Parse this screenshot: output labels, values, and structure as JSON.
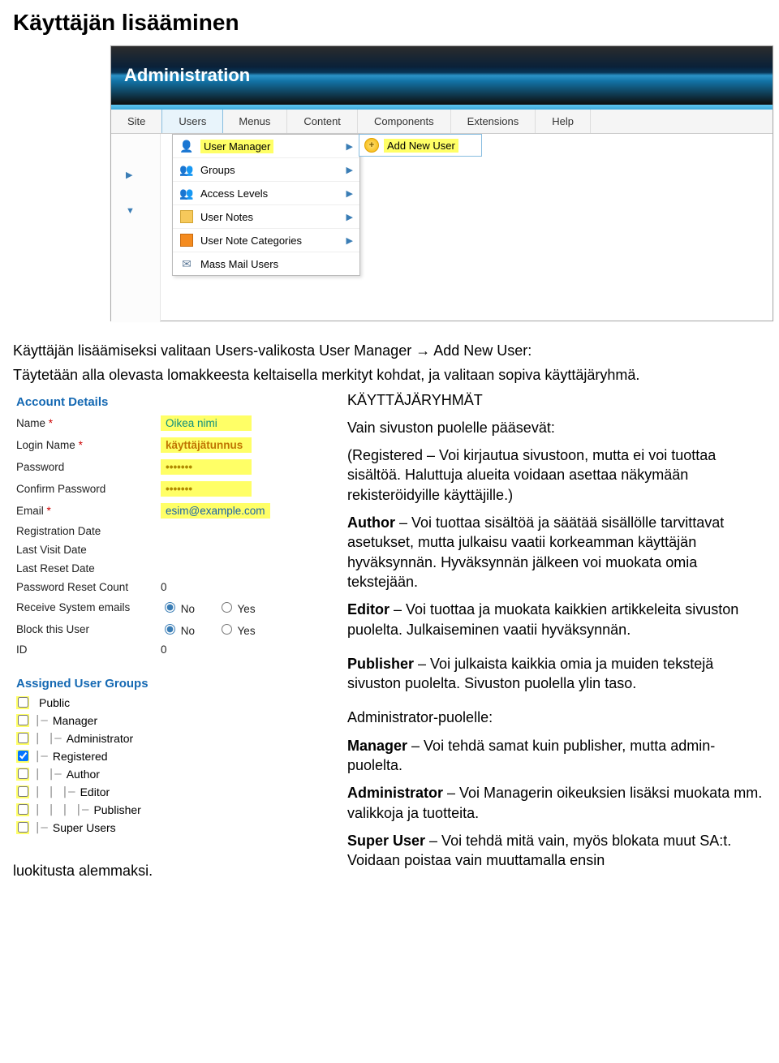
{
  "page_title": "Käyttäjän lisääminen",
  "admin": {
    "header": "Administration",
    "menu": [
      "Site",
      "Users",
      "Menus",
      "Content",
      "Components",
      "Extensions",
      "Help"
    ],
    "active": 1,
    "dropdown": [
      {
        "label": "User Manager",
        "icon": "user",
        "hl": true,
        "arrow": true
      },
      {
        "label": "Groups",
        "icon": "group",
        "arrow": true
      },
      {
        "label": "Access Levels",
        "icon": "group",
        "arrow": true
      },
      {
        "label": "User Notes",
        "icon": "note",
        "arrow": true
      },
      {
        "label": "User Note Categories",
        "icon": "cat",
        "arrow": true
      },
      {
        "label": "Mass Mail Users",
        "icon": "mail",
        "arrow": false
      }
    ],
    "submenu": {
      "label": "Add New User"
    }
  },
  "intro_lines": {
    "l1": "Käyttäjän lisäämiseksi valitaan Users-valikosta User Manager → Add New User:",
    "l2": "Täytetään alla olevasta lomakkeesta keltaisella merkityt kohdat, ja valitaan sopiva käyttäjäryhmä."
  },
  "form": {
    "heading": "Account Details",
    "rows": {
      "name_lbl": "Name",
      "name_val": "Oikea nimi",
      "login_lbl": "Login Name",
      "login_val": "käyttäjätunnus",
      "pw_lbl": "Password",
      "pw_val": "•••••••",
      "cpw_lbl": "Confirm Password",
      "cpw_val": "•••••••",
      "email_lbl": "Email",
      "email_val": "esim@example.com",
      "regdate_lbl": "Registration Date",
      "lastvisit_lbl": "Last Visit Date",
      "lastreset_lbl": "Last Reset Date",
      "pwreset_lbl": "Password Reset Count",
      "pwreset_val": "0",
      "sysmail_lbl": "Receive System emails",
      "block_lbl": "Block this User",
      "id_lbl": "ID",
      "id_val": "0",
      "no": "No",
      "yes": "Yes"
    }
  },
  "groups": {
    "heading": "Assigned User Groups",
    "items": [
      {
        "label": "Public",
        "indent": "",
        "checked": false
      },
      {
        "label": "Manager",
        "indent": "|— ",
        "checked": false
      },
      {
        "label": "Administrator",
        "indent": "|    |— ",
        "checked": false
      },
      {
        "label": "Registered",
        "indent": "|— ",
        "checked": true
      },
      {
        "label": "Author",
        "indent": "|    |— ",
        "checked": false
      },
      {
        "label": "Editor",
        "indent": "|    |    |— ",
        "checked": false
      },
      {
        "label": "Publisher",
        "indent": "|    |    |    |— ",
        "checked": false
      },
      {
        "label": "Super Users",
        "indent": "|— ",
        "checked": false
      }
    ]
  },
  "right": {
    "h1": "KÄYTTÄJÄRYHMÄT",
    "h2": "Vain sivuston puolelle pääsevät:",
    "reg": "(Registered – Voi kirjautua sivustoon, mutta ei voi tuottaa sisältöä. Haluttuja alueita voidaan asettaa näkymään rekisteröidyille käyttäjille.)",
    "author_b": "Author",
    "author": " – Voi tuottaa sisältöä ja säätää sisällölle tarvittavat asetukset, mutta julkaisu vaatii korkeamman käyttäjän hyväksynnän. Hyväksynnän jälkeen voi muokata omia tekstejään.",
    "editor_b": "Editor",
    "editor": " – Voi tuottaa ja muokata kaikkien artikkeleita sivuston puolelta. Julkaiseminen vaatii hyväksynnän.",
    "publisher_b": "Publisher",
    "publisher": " – Voi julkaista kaikkia omia ja muiden tekstejä sivuston puolelta. Sivuston puolella ylin taso.",
    "admin_h": "Administrator-puolelle:",
    "manager_b": "Manager",
    "manager": " – Voi tehdä samat kuin publisher, mutta admin-puolelta.",
    "administrator_b": "Administrator",
    "administrator": " – Voi Managerin oikeuksien lisäksi muokata mm. valikkoja ja tuotteita.",
    "super_b": "Super User",
    "super": " – Voi tehdä mitä vain, myös blokata muut SA:t. Voidaan poistaa vain muuttamalla ensin"
  },
  "footer": "luokitusta alemmaksi."
}
